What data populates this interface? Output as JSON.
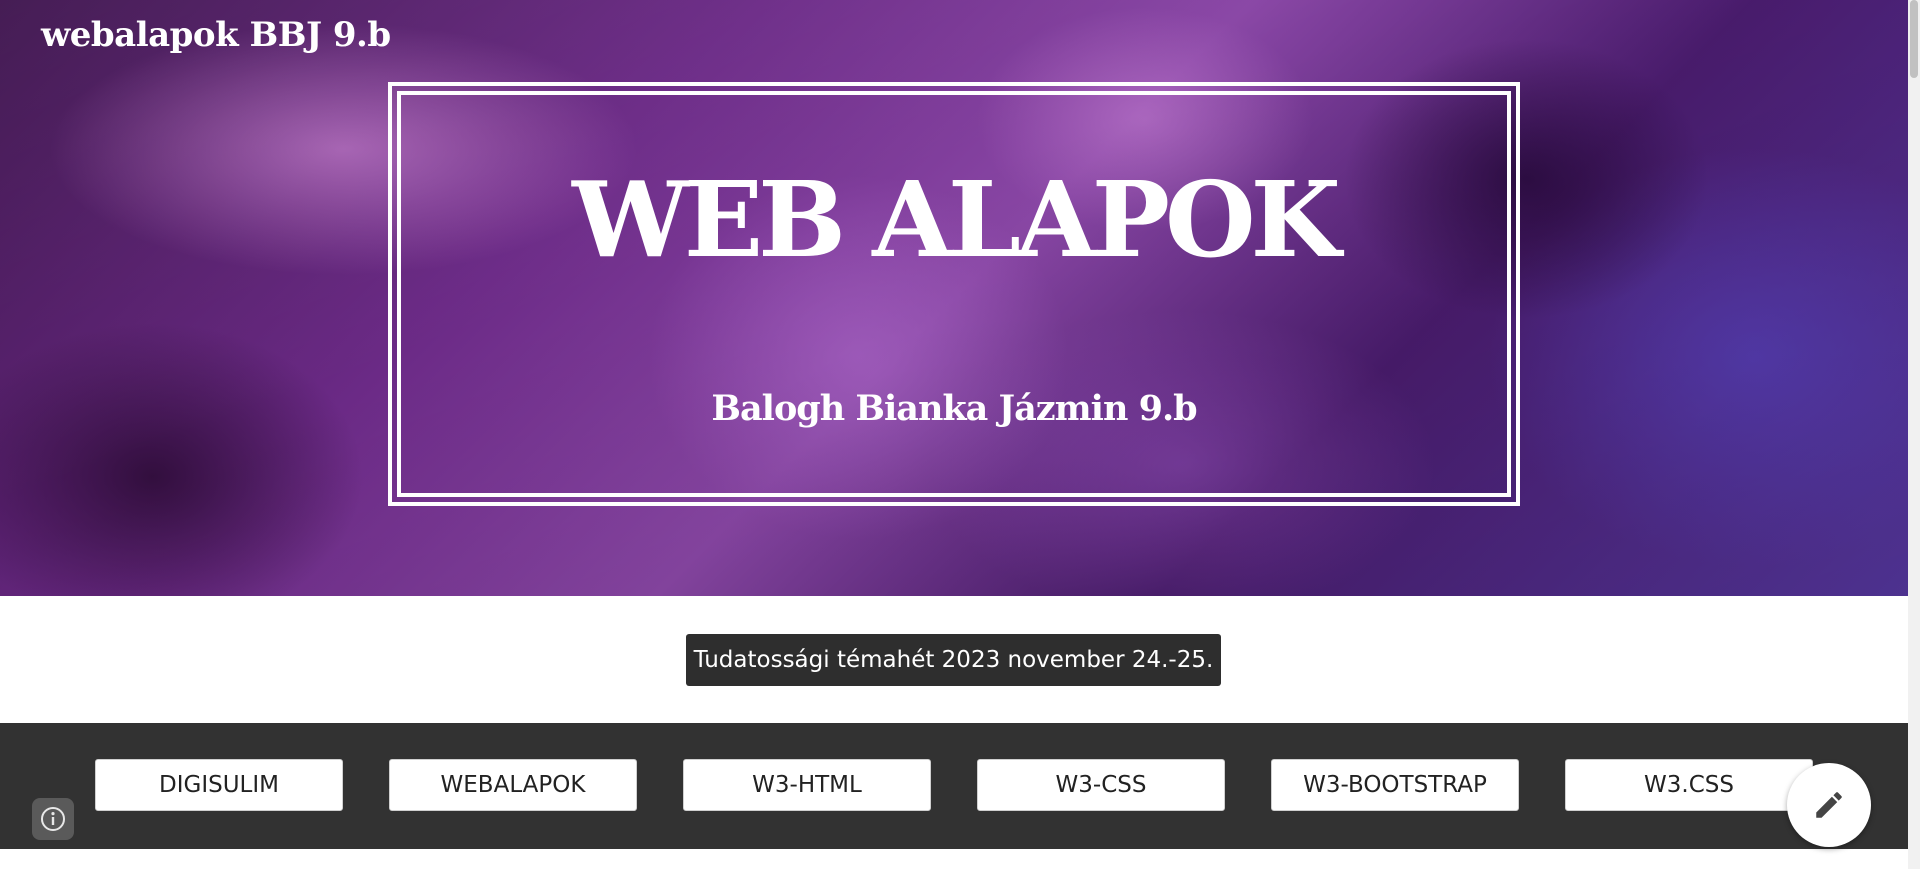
{
  "site": {
    "title": "webalapok BBJ 9.b"
  },
  "hero": {
    "heading": "WEB ALAPOK",
    "subtitle": "Balogh Bianka Jázmin 9.b"
  },
  "announcement": {
    "text": "Tudatossági témahét 2023 november 24.-25."
  },
  "nav": {
    "buttons": [
      {
        "label": "DIGISULIM"
      },
      {
        "label": "WEBALAPOK"
      },
      {
        "label": "W3-HTML"
      },
      {
        "label": "W3-CSS"
      },
      {
        "label": "W3-BOOTSTRAP"
      },
      {
        "label": "W3.CSS"
      }
    ]
  },
  "icons": {
    "info": "info-icon",
    "edit": "pencil-icon"
  },
  "colors": {
    "nav_background": "#323232",
    "announcement_background": "#2e2e2e",
    "accent_purple": "#6b2a86"
  }
}
